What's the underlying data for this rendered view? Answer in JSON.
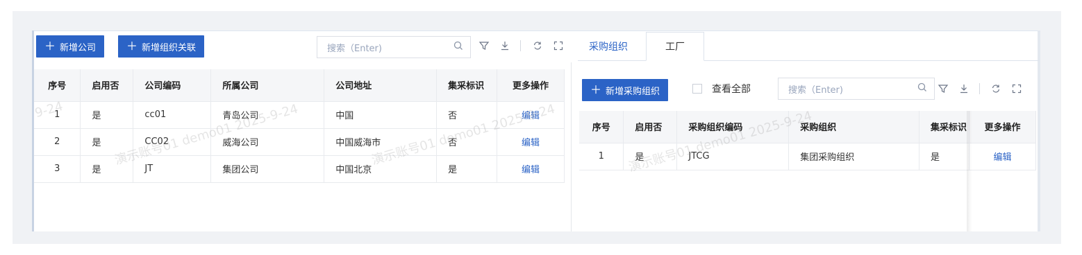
{
  "left": {
    "toolbar": {
      "add_company": "新增公司",
      "add_org_relation": "新增组织关联",
      "search_placeholder": "搜索（Enter)"
    },
    "table": {
      "headers": [
        "序号",
        "启用否",
        "公司编码",
        "所属公司",
        "公司地址",
        "集采标识",
        "更多操作"
      ],
      "rows": [
        {
          "no": "1",
          "enabled": "是",
          "code": "cc01",
          "company": "青岛公司",
          "address": "中国",
          "flag": "否",
          "action": "编辑"
        },
        {
          "no": "2",
          "enabled": "是",
          "code": "CC02",
          "company": "威海公司",
          "address": "中国威海市",
          "flag": "否",
          "action": "编辑"
        },
        {
          "no": "3",
          "enabled": "是",
          "code": "JT",
          "company": "集团公司",
          "address": "中国北京",
          "flag": "是",
          "action": "编辑"
        }
      ]
    }
  },
  "right": {
    "tabs": [
      "采购组织",
      "工厂"
    ],
    "toolbar": {
      "add_purchase_org": "新增采购组织",
      "view_all": "查看全部",
      "search_placeholder": "搜索（Enter)"
    },
    "table": {
      "headers": [
        "序号",
        "启用否",
        "采购组织编码",
        "采购组织",
        "集采标识",
        "更多操作"
      ],
      "rows": [
        {
          "no": "1",
          "enabled": "是",
          "code": "JTCG",
          "org": "集团采购组织",
          "flag": "是",
          "action": "编辑"
        }
      ]
    }
  },
  "watermarks": [
    "9-24",
    "演示账号01 demo01 2025-9-24",
    "演示账号01 demo01 2025-9-24",
    "演示账号01 demo01 2025-9-24"
  ],
  "colors": {
    "primary": "#2b63c6"
  }
}
